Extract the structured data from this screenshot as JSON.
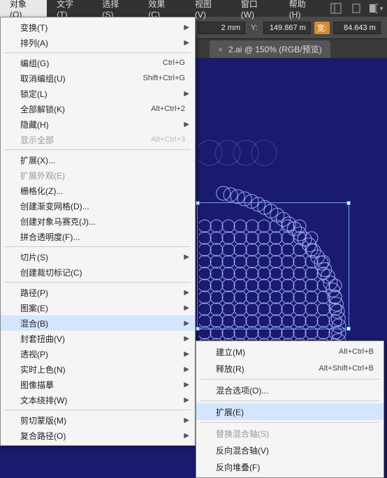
{
  "menubar": {
    "items": [
      "对象(O)",
      "文字(T)",
      "选择(S)",
      "效果(C)",
      "视图(V)",
      "窗口(W)",
      "帮助(H)"
    ]
  },
  "controlbar": {
    "x_suffix": "2 mm",
    "y_label": "Y:",
    "y_value": "149.867 m",
    "w_label": "宽:",
    "w_value": "84.643 m"
  },
  "tab": {
    "title": "2.ai @ 150% (RGB/预览)",
    "close": "×"
  },
  "menu": {
    "transform": "变换(T)",
    "arrange": "排列(A)",
    "group": "编组(G)",
    "group_sc": "Ctrl+G",
    "ungroup": "取消编组(U)",
    "ungroup_sc": "Shift+Ctrl+G",
    "lock": "锁定(L)",
    "unlock_all": "全部解锁(K)",
    "unlock_all_sc": "Alt+Ctrl+2",
    "hide": "隐藏(H)",
    "show_all": "显示全部",
    "show_all_sc": "Alt+Ctrl+3",
    "expand": "扩展(X)...",
    "expand_appearance": "扩展外观(E)",
    "rasterize": "栅格化(Z)...",
    "gradient_mesh": "创建渐变网格(D)...",
    "object_mosaic": "创建对象马赛克(J)...",
    "flatten": "拼合透明度(F)...",
    "slice": "切片(S)",
    "crop_marks": "创建裁切标记(C)",
    "path": "路径(P)",
    "pattern": "图案(E)",
    "blend": "混合(B)",
    "envelope": "封套扭曲(V)",
    "perspective": "透视(P)",
    "live_paint": "实时上色(N)",
    "image_trace": "图像描摹",
    "text_wrap": "文本绕排(W)",
    "clipping_mask": "剪切蒙版(M)",
    "compound_path": "复合路径(O)"
  },
  "submenu": {
    "make": "建立(M)",
    "make_sc": "Alt+Ctrl+B",
    "release": "释放(R)",
    "release_sc": "Alt+Shift+Ctrl+B",
    "options": "混合选项(O)...",
    "expand": "扩展(E)",
    "replace_spine": "替换混合轴(S)",
    "reverse_spine": "反向混合轴(V)",
    "reverse_front": "反向堆叠(F)"
  }
}
